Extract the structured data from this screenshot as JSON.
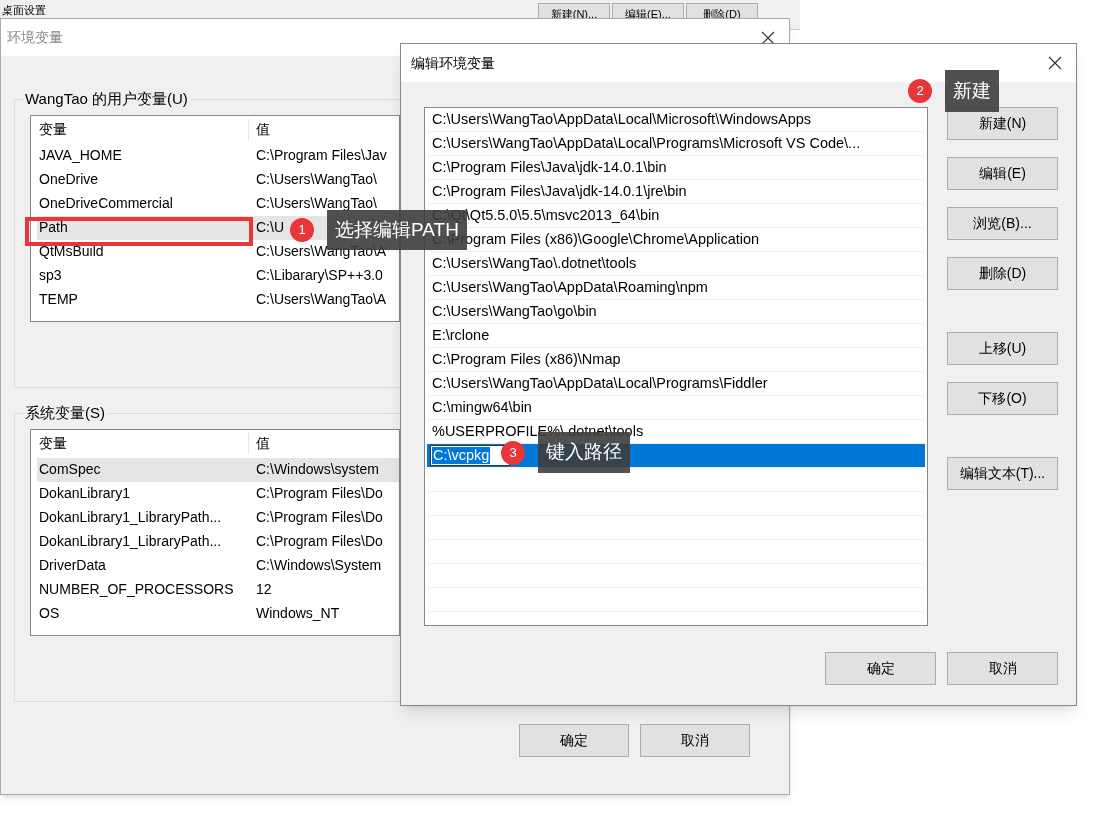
{
  "background_window": {
    "label": "桌面设置",
    "buttons": [
      "新建(N)...",
      "编辑(E)...",
      "删除(D)"
    ]
  },
  "env_dialog": {
    "title": "环境变量",
    "user_group": {
      "label": "WangTao 的用户变量(U)",
      "columns": [
        "变量",
        "值"
      ],
      "rows": [
        {
          "name": "JAVA_HOME",
          "value": "C:\\Program Files\\Jav",
          "selected": false
        },
        {
          "name": "OneDrive",
          "value": "C:\\Users\\WangTao\\",
          "selected": false
        },
        {
          "name": "OneDriveCommercial",
          "value": "C:\\Users\\WangTao\\",
          "selected": false
        },
        {
          "name": "Path",
          "value": "C:\\U",
          "selected": true
        },
        {
          "name": "QtMsBuild",
          "value": "C:\\Users\\WangTao\\A",
          "selected": false
        },
        {
          "name": "sp3",
          "value": "C:\\Libarary\\SP++3.0",
          "selected": false
        },
        {
          "name": "TEMP",
          "value": "C:\\Users\\WangTao\\A",
          "selected": false
        }
      ]
    },
    "system_group": {
      "label": "系统变量(S)",
      "columns": [
        "变量",
        "值"
      ],
      "rows": [
        {
          "name": "ComSpec",
          "value": "C:\\Windows\\system",
          "selected": true
        },
        {
          "name": "DokanLibrary1",
          "value": "C:\\Program Files\\Do",
          "selected": false
        },
        {
          "name": "DokanLibrary1_LibraryPath...",
          "value": "C:\\Program Files\\Do",
          "selected": false
        },
        {
          "name": "DokanLibrary1_LibraryPath...",
          "value": "C:\\Program Files\\Do",
          "selected": false
        },
        {
          "name": "DriverData",
          "value": "C:\\Windows\\System",
          "selected": false
        },
        {
          "name": "NUMBER_OF_PROCESSORS",
          "value": "12",
          "selected": false
        },
        {
          "name": "OS",
          "value": "Windows_NT",
          "selected": false
        }
      ]
    },
    "buttons": [
      "确定",
      "取消"
    ]
  },
  "edit_dialog": {
    "title": "编辑环境变量",
    "paths": [
      {
        "text": "C:\\Users\\WangTao\\AppData\\Local\\Microsoft\\WindowsApps",
        "selected": false,
        "editing": false
      },
      {
        "text": "C:\\Users\\WangTao\\AppData\\Local\\Programs\\Microsoft VS Code\\...",
        "selected": false,
        "editing": false
      },
      {
        "text": "C:\\Program Files\\Java\\jdk-14.0.1\\bin",
        "selected": false,
        "editing": false
      },
      {
        "text": "C:\\Program Files\\Java\\jdk-14.0.1\\jre\\bin",
        "selected": false,
        "editing": false
      },
      {
        "text": "C:\\Qt\\Qt5.5.0\\5.5\\msvc2013_64\\bin",
        "selected": false,
        "editing": false
      },
      {
        "text": "C:\\Program Files (x86)\\Google\\Chrome\\Application",
        "selected": false,
        "editing": false
      },
      {
        "text": "C:\\Users\\WangTao\\.dotnet\\tools",
        "selected": false,
        "editing": false
      },
      {
        "text": "C:\\Users\\WangTao\\AppData\\Roaming\\npm",
        "selected": false,
        "editing": false
      },
      {
        "text": "C:\\Users\\WangTao\\go\\bin",
        "selected": false,
        "editing": false
      },
      {
        "text": "E:\\rclone",
        "selected": false,
        "editing": false
      },
      {
        "text": "C:\\Program Files (x86)\\Nmap",
        "selected": false,
        "editing": false
      },
      {
        "text": "C:\\Users\\WangTao\\AppData\\Local\\Programs\\Fiddler",
        "selected": false,
        "editing": false
      },
      {
        "text": "C:\\mingw64\\bin",
        "selected": false,
        "editing": false
      },
      {
        "text": "%USERPROFILE%\\.dotnet\\tools",
        "selected": false,
        "editing": false
      },
      {
        "text": "C:\\vcpkg",
        "selected": true,
        "editing": true
      }
    ],
    "side_button_groups": [
      [
        "新建(N)",
        "编辑(E)",
        "浏览(B)...",
        "删除(D)"
      ],
      [
        "上移(U)",
        "下移(O)"
      ],
      [
        "编辑文本(T)..."
      ]
    ],
    "buttons": [
      "确定",
      "取消"
    ]
  },
  "annotations": [
    {
      "number": "1",
      "label": "选择编辑PATH"
    },
    {
      "number": "2",
      "label": "新建"
    },
    {
      "number": "3",
      "label": "键入路径"
    }
  ]
}
